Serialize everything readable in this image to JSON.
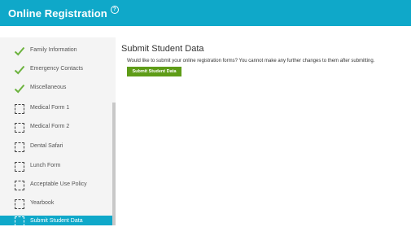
{
  "header": {
    "title": "Online Registration",
    "help_icon": "?"
  },
  "sidebar": {
    "items": [
      {
        "label": "Family Information",
        "icon": "checkmark-icon",
        "status": "complete"
      },
      {
        "label": "Emergency Contacts",
        "icon": "checkmark-icon",
        "status": "complete"
      },
      {
        "label": "Miscellaneous",
        "icon": "checkmark-icon",
        "status": "complete"
      },
      {
        "label": "Medical Form 1",
        "icon": "dashed-box-icon",
        "status": "incomplete"
      },
      {
        "label": "Medical Form 2",
        "icon": "dashed-box-icon",
        "status": "incomplete"
      },
      {
        "label": "Dental Safari",
        "icon": "dashed-box-icon",
        "status": "incomplete"
      },
      {
        "label": "Lunch Form",
        "icon": "dashed-box-icon",
        "status": "incomplete"
      },
      {
        "label": "Acceptable Use Policy",
        "icon": "dashed-box-icon",
        "status": "incomplete"
      },
      {
        "label": "Yearbook",
        "icon": "dashed-box-icon",
        "status": "incomplete"
      },
      {
        "label": "Submit Student Data",
        "icon": "dashed-box-icon",
        "status": "active"
      }
    ]
  },
  "main": {
    "title": "Submit Student Data",
    "message": "Would like to submit your online registration forms? You cannot make any further changes to them after submitting.",
    "submit_label": "Submit Student Data"
  },
  "colors": {
    "header_bg": "#0fa8c9",
    "check_green": "#6cb33e",
    "button_green": "#5e9c17"
  }
}
